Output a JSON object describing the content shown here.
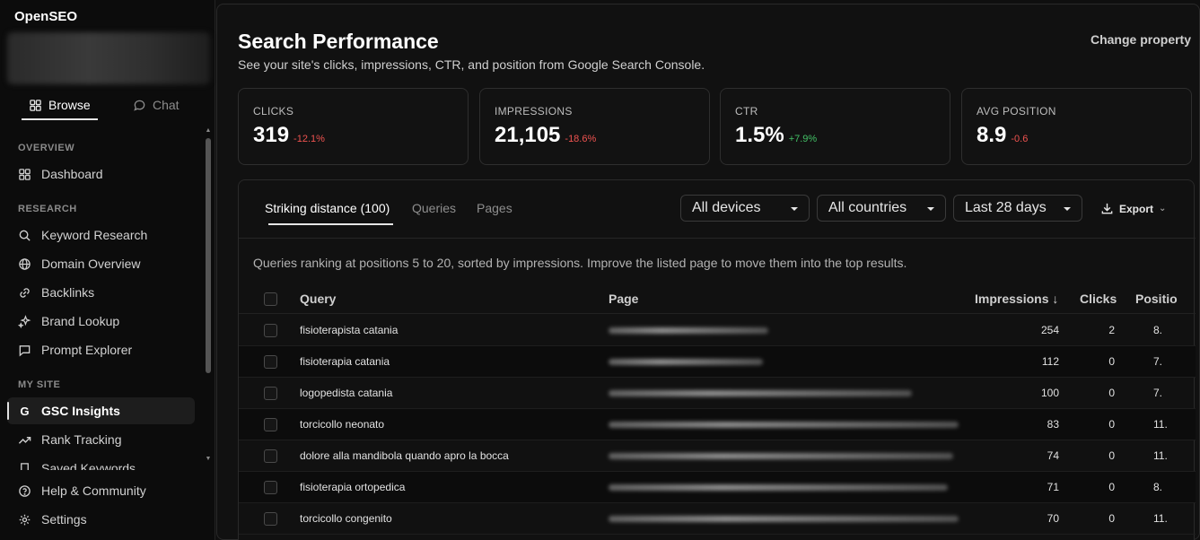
{
  "app": {
    "brand": "OpenSEO"
  },
  "sidebar": {
    "tabs": [
      {
        "label": "Browse",
        "icon": "grid-icon"
      },
      {
        "label": "Chat",
        "icon": "chat-icon"
      }
    ],
    "sections": {
      "overview": "OVERVIEW",
      "research": "RESEARCH",
      "my_site": "MY SITE"
    },
    "items": {
      "dashboard": "Dashboard",
      "keyword_research": "Keyword Research",
      "domain_overview": "Domain Overview",
      "backlinks": "Backlinks",
      "brand_lookup": "Brand Lookup",
      "prompt_explorer": "Prompt Explorer",
      "gsc_insights": "GSC Insights",
      "rank_tracking": "Rank Tracking",
      "saved_keywords": "Saved Keywords"
    },
    "bottom": {
      "help": "Help & Community",
      "settings": "Settings"
    }
  },
  "header": {
    "title": "Search Performance",
    "subtitle": "See your site's clicks, impressions, CTR, and position from Google Search Console.",
    "change_property": "Change property"
  },
  "metrics": [
    {
      "label": "CLICKS",
      "value": "319",
      "delta": "-12.1%",
      "trend": "neg"
    },
    {
      "label": "IMPRESSIONS",
      "value": "21,105",
      "delta": "-18.6%",
      "trend": "neg"
    },
    {
      "label": "CTR",
      "value": "1.5%",
      "delta": "+7.9%",
      "trend": "pos"
    },
    {
      "label": "AVG POSITION",
      "value": "8.9",
      "delta": "-0.6",
      "trend": "neg"
    }
  ],
  "panel": {
    "tabs": [
      "Striking distance (100)",
      "Queries",
      "Pages"
    ],
    "filters": {
      "devices": "All devices",
      "countries": "All countries",
      "range": "Last 28 days"
    },
    "export": "Export",
    "description": "Queries ranking at positions 5 to 20, sorted by impressions. Improve the listed page to move them into the top results."
  },
  "table": {
    "columns": {
      "query": "Query",
      "page": "Page",
      "impressions": "Impressions ↓",
      "clicks": "Clicks",
      "position": "Positio"
    },
    "rows": [
      {
        "query": "fisioterapista catania",
        "impressions": "254",
        "clicks": "2",
        "position": "8."
      },
      {
        "query": "fisioterapia catania",
        "impressions": "112",
        "clicks": "0",
        "position": "7."
      },
      {
        "query": "logopedista catania",
        "impressions": "100",
        "clicks": "0",
        "position": "7."
      },
      {
        "query": "torcicollo neonato",
        "impressions": "83",
        "clicks": "0",
        "position": "11."
      },
      {
        "query": "dolore alla mandibola quando apro la bocca",
        "impressions": "74",
        "clicks": "0",
        "position": "11."
      },
      {
        "query": "fisioterapia ortopedica",
        "impressions": "71",
        "clicks": "0",
        "position": "8."
      },
      {
        "query": "torcicollo congenito",
        "impressions": "70",
        "clicks": "0",
        "position": "11."
      }
    ]
  }
}
